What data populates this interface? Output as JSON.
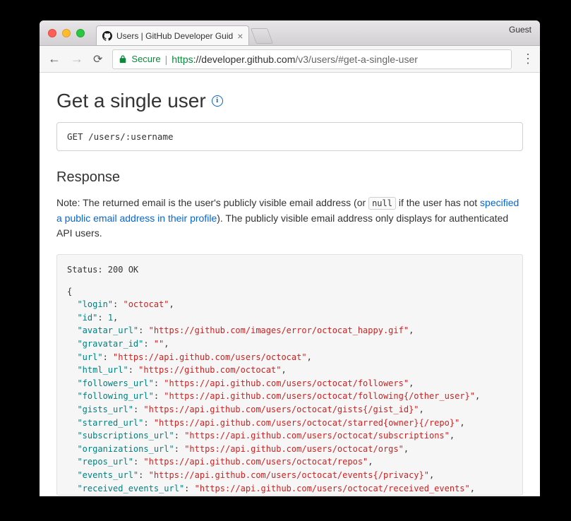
{
  "browser": {
    "tab_title": "Users | GitHub Developer Guid",
    "guest_label": "Guest",
    "secure_label": "Secure",
    "url_scheme": "https",
    "url_host": "://developer.github.com",
    "url_path": "/v3/users/#get-a-single-user"
  },
  "page": {
    "title": "Get a single user",
    "endpoint": "GET /users/:username",
    "response_heading": "Response",
    "note_prefix": "Note: The returned email is the user's publicly visible email address (or ",
    "note_null": "null",
    "note_mid": " if the user has not ",
    "note_link": "specified a public email address in their profile",
    "note_suffix": "). The publicly visible email address only displays for authenticated API users.",
    "status_line": "Status: 200 OK"
  },
  "response_json": [
    {
      "key": "login",
      "type": "string",
      "value": "octocat",
      "comma": true
    },
    {
      "key": "id",
      "type": "number",
      "value": "1",
      "comma": true
    },
    {
      "key": "avatar_url",
      "type": "string",
      "value": "https://github.com/images/error/octocat_happy.gif",
      "comma": true
    },
    {
      "key": "gravatar_id",
      "type": "string",
      "value": "",
      "comma": true
    },
    {
      "key": "url",
      "type": "string",
      "value": "https://api.github.com/users/octocat",
      "comma": true
    },
    {
      "key": "html_url",
      "type": "string",
      "value": "https://github.com/octocat",
      "comma": true
    },
    {
      "key": "followers_url",
      "type": "string",
      "value": "https://api.github.com/users/octocat/followers",
      "comma": true
    },
    {
      "key": "following_url",
      "type": "string",
      "value": "https://api.github.com/users/octocat/following{/other_user}",
      "comma": true
    },
    {
      "key": "gists_url",
      "type": "string",
      "value": "https://api.github.com/users/octocat/gists{/gist_id}",
      "comma": true
    },
    {
      "key": "starred_url",
      "type": "string",
      "value": "https://api.github.com/users/octocat/starred{owner}{/repo}",
      "comma": true
    },
    {
      "key": "subscriptions_url",
      "type": "string",
      "value": "https://api.github.com/users/octocat/subscriptions",
      "comma": true
    },
    {
      "key": "organizations_url",
      "type": "string",
      "value": "https://api.github.com/users/octocat/orgs",
      "comma": true
    },
    {
      "key": "repos_url",
      "type": "string",
      "value": "https://api.github.com/users/octocat/repos",
      "comma": true
    },
    {
      "key": "events_url",
      "type": "string",
      "value": "https://api.github.com/users/octocat/events{/privacy}",
      "comma": true
    },
    {
      "key": "received_events_url",
      "type": "string",
      "value": "https://api.github.com/users/octocat/received_events",
      "comma": true
    }
  ]
}
